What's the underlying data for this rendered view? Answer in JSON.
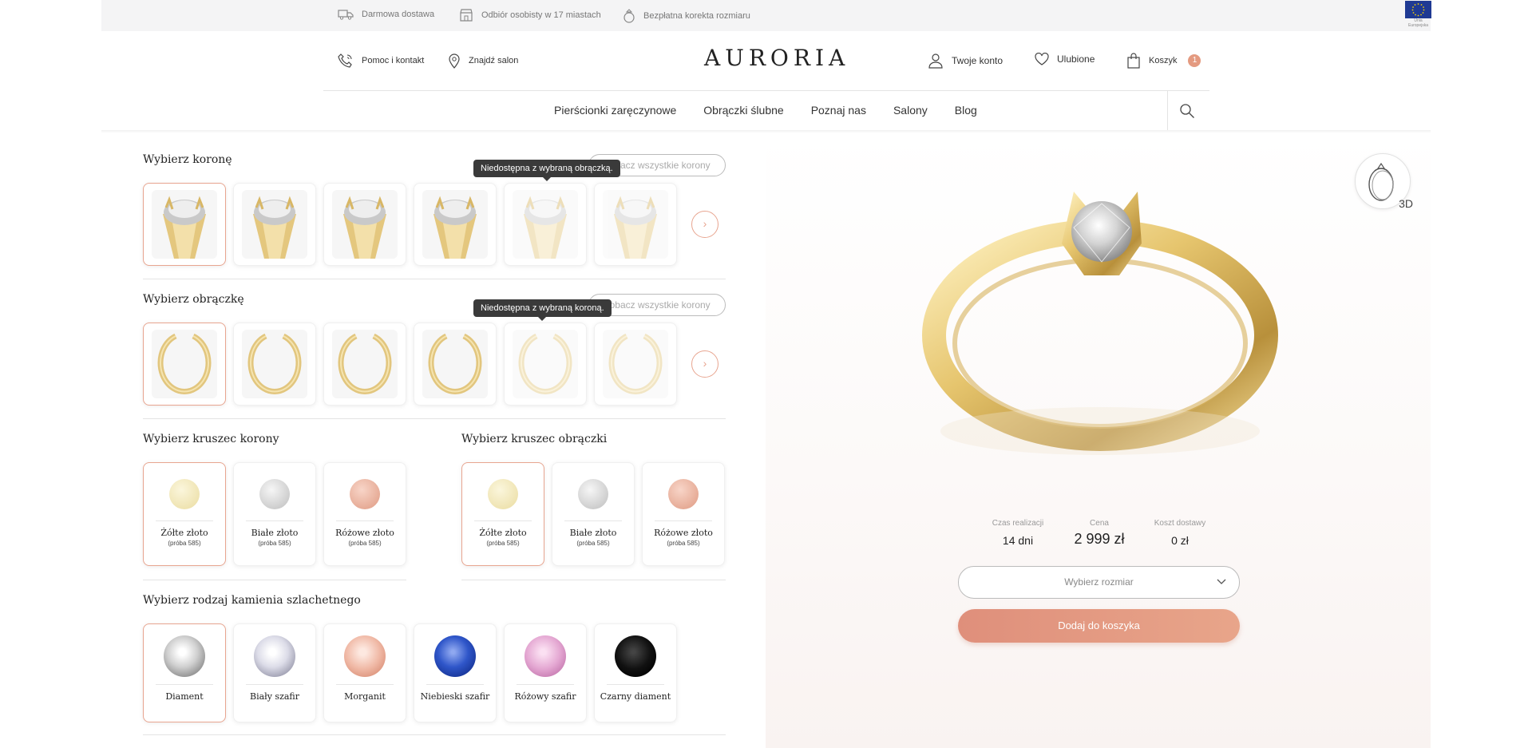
{
  "topbar": {
    "items": [
      {
        "label": "Darmowa dostawa",
        "icon": "truck-icon"
      },
      {
        "label": "Odbiór osobisty w 17 miastach",
        "icon": "store-icon"
      },
      {
        "label": "Bezpłatna korekta rozmiaru",
        "icon": "ring-icon"
      }
    ],
    "eu_label": "Unia Europejska"
  },
  "header": {
    "help": "Pomoc i kontakt",
    "salon": "Znajdź salon",
    "logo": "AURORIA",
    "account": "Twoje konto",
    "favorites": "Ulubione",
    "cart": "Koszyk",
    "cart_count": "1"
  },
  "nav": [
    "Pierścionki zaręczynowe",
    "Obrączki ślubne",
    "Poznaj nas",
    "Salony",
    "Blog"
  ],
  "crown": {
    "title": "Wybierz koronę",
    "see_all": "Zobacz wszystkie korony",
    "tooltip": "Niedostępna z wybraną obrączką."
  },
  "band": {
    "title": "Wybierz obrączkę",
    "see_all": "Zobacz wszystkie korony",
    "tooltip": "Niedostępna z wybraną koroną."
  },
  "crown_metal": {
    "title": "Wybierz kruszec korony",
    "options": [
      {
        "name": "Żółte złoto",
        "sub": "(próba 585)"
      },
      {
        "name": "Białe złoto",
        "sub": "(próba 585)"
      },
      {
        "name": "Różowe złoto",
        "sub": "(próba 585)"
      }
    ]
  },
  "band_metal": {
    "title": "Wybierz kruszec obrączki",
    "options": [
      {
        "name": "Żółte złoto",
        "sub": "(próba 585)"
      },
      {
        "name": "Białe złoto",
        "sub": "(próba 585)"
      },
      {
        "name": "Różowe złoto",
        "sub": "(próba 585)"
      }
    ]
  },
  "stone": {
    "title": "Wybierz rodzaj kamienia szlachetnego",
    "options": [
      "Diament",
      "Biały szafir",
      "Morganit",
      "Niebieski szafir",
      "Różowy szafir",
      "Czarny diament"
    ]
  },
  "product": {
    "btn_3d": "3D",
    "lead_time_label": "Czas realizacji",
    "lead_time": "14 dni",
    "price_label": "Cena",
    "price": "2 999 zł",
    "shipping_label": "Koszt dostawy",
    "shipping": "0 zł",
    "size_placeholder": "Wybierz rozmiar",
    "add_to_cart": "Dodaj do koszyka"
  },
  "colors": {
    "accent": "#e49a80",
    "yellow_gold": "#f0e3b0",
    "white_gold": "#d9d9d9",
    "rose_gold": "#e8a590"
  }
}
